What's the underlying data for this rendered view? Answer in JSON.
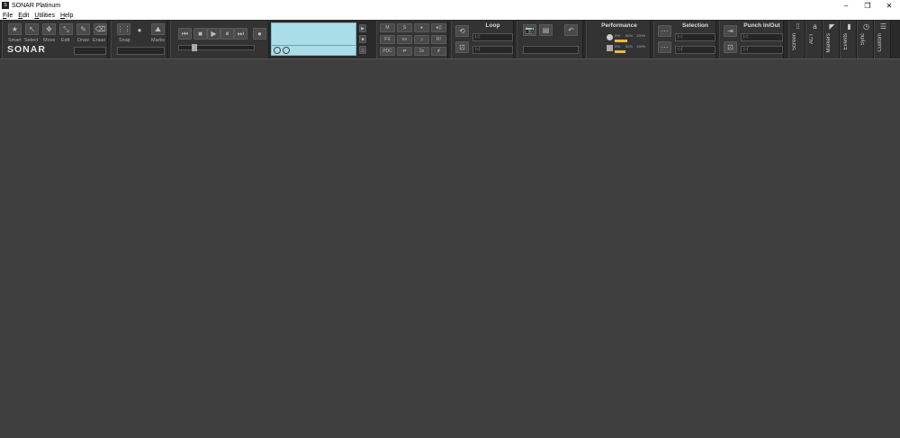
{
  "window": {
    "title": "SONAR Platinum",
    "app_icon": "sonar-app-icon",
    "minimize_glyph": "–",
    "restore_glyph": "❐",
    "close_glyph": "✕"
  },
  "menu": {
    "items": [
      {
        "label": "File",
        "underline": "F",
        "rest": "ile"
      },
      {
        "label": "Edit",
        "underline": "E",
        "rest": "dit"
      },
      {
        "label": "Utilities",
        "underline": "U",
        "rest": "tilities"
      },
      {
        "label": "Help",
        "underline": "H",
        "rest": "elp"
      }
    ]
  },
  "tools": {
    "items": [
      "Smart",
      "Select",
      "Move",
      "Edit",
      "Draw",
      "Erase"
    ],
    "logo": "SONAR"
  },
  "snap": {
    "snap_label": "Snap",
    "marks_label": "Marks"
  },
  "loop": {
    "title": "Loop"
  },
  "performance": {
    "title": "Performance",
    "row1": [
      "0%",
      "50%",
      "100%"
    ],
    "row2": [
      "0%",
      "50%",
      "100%"
    ]
  },
  "selection": {
    "title": "Selection"
  },
  "punch": {
    "title": "Punch In/Out"
  },
  "mix": {
    "row1": [
      "M",
      "S",
      "●",
      "●))"
    ],
    "row2": [
      "FX",
      "≡≡",
      "♫",
      "R!"
    ],
    "row3": [
      "PDC",
      "⇄",
      "2x",
      "✗"
    ]
  },
  "vtabs": [
    "Screen",
    "ACT",
    "Markers",
    "Events",
    "Sync",
    "Custom"
  ],
  "colors": {
    "lcd": "#a9dde8",
    "meter": "#e8b64a",
    "toolbar": "#2a2a2a",
    "workspace": "#3f3f3f"
  }
}
